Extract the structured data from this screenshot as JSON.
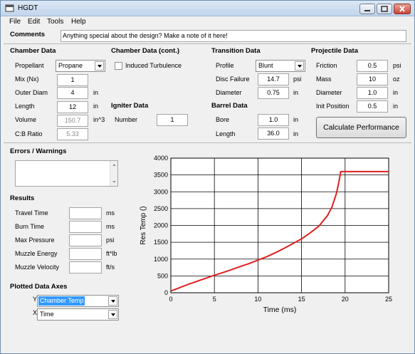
{
  "window": {
    "title": "HGDT"
  },
  "menu": [
    "File",
    "Edit",
    "Tools",
    "Help"
  ],
  "comments": {
    "label": "Comments",
    "value": "Anything special about the design?  Make a note of it here!"
  },
  "chamber": {
    "heading": "Chamber Data",
    "propellant_label": "Propellant",
    "propellant_value": "Propane",
    "mix_label": "Mix (Nx)",
    "mix_value": "1",
    "outer_diam_label": "Outer Diam",
    "outer_diam_value": "4",
    "outer_diam_unit": "in",
    "length_label": "Length",
    "length_value": "12",
    "length_unit": "in",
    "volume_label": "Volume",
    "volume_value": "150.7",
    "volume_unit": "in^3",
    "cb_ratio_label": "C:B Ratio",
    "cb_ratio_value": "5.33"
  },
  "chamber_cont": {
    "heading": "Chamber Data (cont.)",
    "induced_turbulence_label": "Induced Turbulence",
    "induced_turbulence_checked": false
  },
  "igniter": {
    "heading": "Igniter Data",
    "number_label": "Number",
    "number_value": "1"
  },
  "transition": {
    "heading": "Transition Data",
    "profile_label": "Profile",
    "profile_value": "Blunt",
    "disc_failure_label": "Disc Failure",
    "disc_failure_value": "14.7",
    "disc_failure_unit": "psi",
    "diameter_label": "Diameter",
    "diameter_value": "0.75",
    "diameter_unit": "in"
  },
  "barrel": {
    "heading": "Barrel Data",
    "bore_label": "Bore",
    "bore_value": "1.0",
    "bore_unit": "in",
    "length_label": "Length",
    "length_value": "36.0",
    "length_unit": "in"
  },
  "projectile": {
    "heading": "Projectile Data",
    "friction_label": "Friction",
    "friction_value": "0.5",
    "friction_unit": "psi",
    "mass_label": "Mass",
    "mass_value": "10",
    "mass_unit": "oz",
    "diameter_label": "Diameter",
    "diameter_value": "1.0",
    "diameter_unit": "in",
    "init_position_label": "Init Position",
    "init_position_value": "0.5",
    "init_position_unit": "in"
  },
  "calculate_button": "Calculate Performance",
  "errors": {
    "heading": "Errors / Warnings"
  },
  "results": {
    "heading": "Results",
    "rows": [
      {
        "label": "Travel Time",
        "value": "",
        "unit": "ms"
      },
      {
        "label": "Burn Time",
        "value": "",
        "unit": "ms"
      },
      {
        "label": "Max Pressure",
        "value": "",
        "unit": "psi"
      },
      {
        "label": "Muzzle Energy",
        "value": "",
        "unit": "ft*lb"
      },
      {
        "label": "Muzzle Velocity",
        "value": "",
        "unit": "ft/s"
      }
    ]
  },
  "plot_axes": {
    "heading": "Plotted Data Axes",
    "y_label": "Y",
    "y_value": "Chamber Temp",
    "x_label": "X",
    "x_value": "Time"
  },
  "colors": {
    "line": "#e02020",
    "selection": "#3399ff"
  },
  "chart_data": {
    "type": "line",
    "xlabel": "Time (ms)",
    "ylabel": "Res Temp ()",
    "xlim": [
      0,
      25
    ],
    "ylim": [
      0,
      4000
    ],
    "xticks": [
      "0",
      "5",
      "10",
      "15",
      "20",
      "25"
    ],
    "yticks": [
      "0",
      "500",
      "1000",
      "1500",
      "2000",
      "2500",
      "3000",
      "3500",
      "4000"
    ],
    "grid": true,
    "series": [
      {
        "x": [
          0,
          1,
          2,
          3,
          4,
          5,
          6,
          7,
          8,
          9,
          10,
          11,
          12,
          13,
          14,
          15,
          16,
          17,
          18,
          18.5,
          19,
          19.3,
          19.5,
          20,
          21,
          22,
          23,
          24,
          25
        ],
        "y": [
          50,
          150,
          250,
          340,
          430,
          520,
          600,
          690,
          780,
          870,
          970,
          1070,
          1190,
          1320,
          1460,
          1600,
          1780,
          1980,
          2300,
          2550,
          2950,
          3300,
          3600,
          3600,
          3600,
          3600,
          3600,
          3600,
          3600
        ]
      }
    ]
  }
}
